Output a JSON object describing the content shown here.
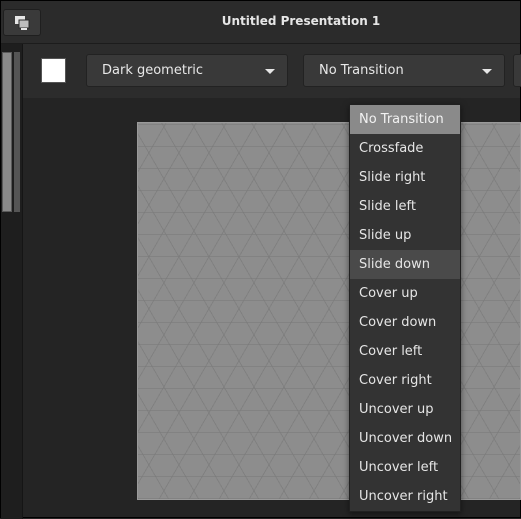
{
  "window": {
    "title": "Untitled Presentation 1"
  },
  "toolbar": {
    "color_swatch": "#ffffff",
    "theme_select": {
      "value": "Dark geometric"
    },
    "transition_select": {
      "value": "No Transition"
    }
  },
  "transition_menu": {
    "items": [
      {
        "label": "No Transition",
        "state": "selected"
      },
      {
        "label": "Crossfade",
        "state": ""
      },
      {
        "label": "Slide right",
        "state": ""
      },
      {
        "label": "Slide left",
        "state": ""
      },
      {
        "label": "Slide up",
        "state": ""
      },
      {
        "label": "Slide down",
        "state": "hover"
      },
      {
        "label": "Cover up",
        "state": ""
      },
      {
        "label": "Cover down",
        "state": ""
      },
      {
        "label": "Cover left",
        "state": ""
      },
      {
        "label": "Cover right",
        "state": ""
      },
      {
        "label": "Uncover up",
        "state": ""
      },
      {
        "label": "Uncover down",
        "state": ""
      },
      {
        "label": "Uncover left",
        "state": ""
      },
      {
        "label": "Uncover right",
        "state": ""
      }
    ]
  }
}
